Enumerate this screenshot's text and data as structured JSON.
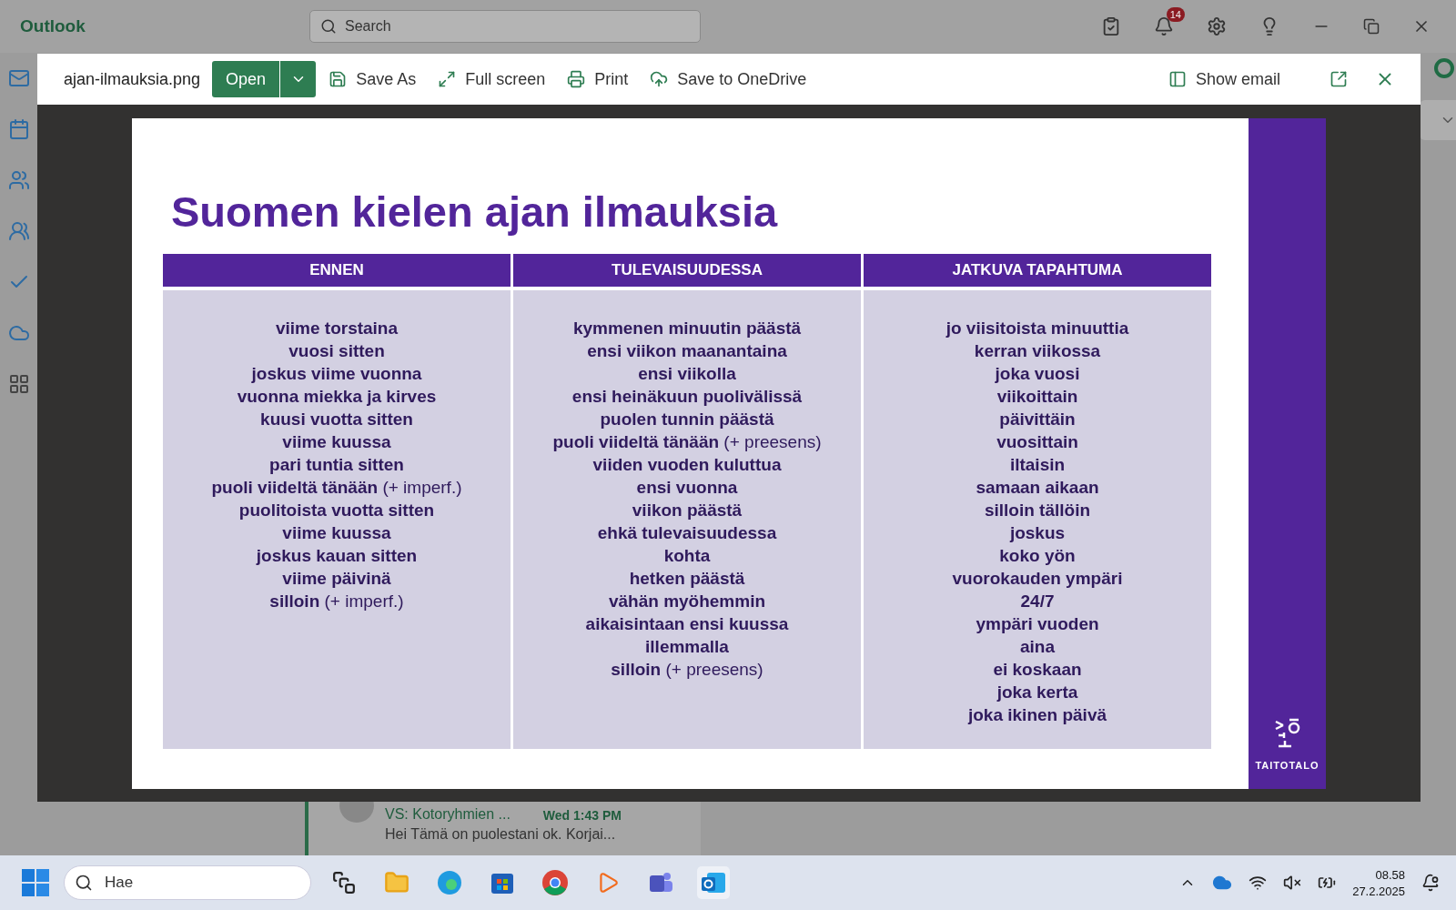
{
  "app": {
    "title": "Outlook",
    "search": {
      "placeholder": "Search"
    },
    "notifications": "14"
  },
  "attachment_viewer": {
    "filename": "ajan-ilmauksia.png",
    "open_button": "Open",
    "actions": [
      {
        "kind": "save",
        "label": "Save As"
      },
      {
        "kind": "fullscreen",
        "label": "Full screen"
      },
      {
        "kind": "print",
        "label": "Print"
      },
      {
        "kind": "cloud",
        "label": "Save to OneDrive"
      }
    ],
    "show_email": "Show email",
    "slide": {
      "title": "Suomen kielen ajan ilmauksia",
      "logo_text": "TAITOTALO",
      "columns": [
        {
          "heading": "ENNEN",
          "lines": [
            {
              "text": "viime torstaina"
            },
            {
              "text": "vuosi sitten"
            },
            {
              "text": "joskus viime vuonna"
            },
            {
              "text": "vuonna miekka ja kirves"
            },
            {
              "text": "kuusi vuotta sitten"
            },
            {
              "text": "viime kuussa"
            },
            {
              "text": "pari tuntia sitten"
            },
            {
              "text": "puoli viideltä tänään",
              "note": "(+ imperf.)"
            },
            {
              "text": "puolitoista vuotta sitten"
            },
            {
              "text": "viime kuussa"
            },
            {
              "text": "joskus kauan sitten"
            },
            {
              "text": "viime päivinä"
            },
            {
              "text": "silloin",
              "note": "(+ imperf.)"
            }
          ]
        },
        {
          "heading": "TULEVAISUUDESSA",
          "lines": [
            {
              "text": "kymmenen minuutin päästä"
            },
            {
              "text": "ensi viikon maanantaina"
            },
            {
              "text": "ensi viikolla"
            },
            {
              "text": "ensi heinäkuun puolivälissä"
            },
            {
              "text": "puolen tunnin päästä"
            },
            {
              "text": "puoli viideltä tänään",
              "note": "(+ preesens)"
            },
            {
              "text": "viiden vuoden kuluttua"
            },
            {
              "text": "ensi vuonna"
            },
            {
              "text": "viikon päästä"
            },
            {
              "text": "ehkä tulevaisuudessa"
            },
            {
              "text": "kohta"
            },
            {
              "text": "hetken päästä"
            },
            {
              "text": "vähän myöhemmin"
            },
            {
              "text": "aikaisintaan ensi kuussa"
            },
            {
              "text": "illemmalla"
            },
            {
              "text": "silloin",
              "note": "(+ preesens)"
            }
          ]
        },
        {
          "heading": "JATKUVA TAPAHTUMA",
          "lines": [
            {
              "text": "jo viisitoista minuuttia"
            },
            {
              "text": "kerran viikossa"
            },
            {
              "text": "joka vuosi"
            },
            {
              "text": "viikoittain"
            },
            {
              "text": "päivittäin"
            },
            {
              "text": "vuosittain"
            },
            {
              "text": "iltaisin"
            },
            {
              "text": "samaan aikaan"
            },
            {
              "text": "silloin tällöin"
            },
            {
              "text": "joskus"
            },
            {
              "text": "koko yön"
            },
            {
              "text": "vuorokauden ympäri"
            },
            {
              "text": "24/7"
            },
            {
              "text": "ympäri vuoden"
            },
            {
              "text": "aina"
            },
            {
              "text": "ei koskaan"
            },
            {
              "text": "joka kerta"
            },
            {
              "text": "joka ikinen päivä"
            }
          ]
        }
      ]
    }
  },
  "message_list": [
    {
      "subject": "VS: Kotoryhmien ...",
      "time": "Wed 1:43 PM",
      "preview": "Hei Tämä on puolestani ok. Korjai...",
      "selected": true
    }
  ],
  "taskbar": {
    "search": {
      "placeholder": "Hae"
    },
    "time": "08.58",
    "date": "27.2.2025"
  }
}
